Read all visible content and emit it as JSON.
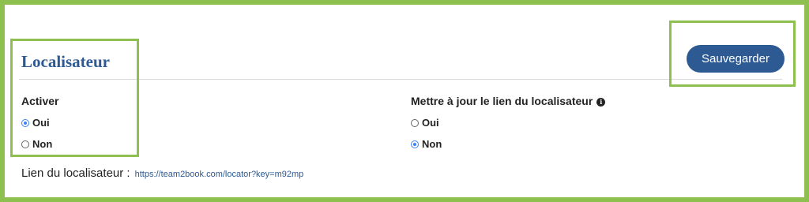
{
  "section": {
    "title": "Localisateur"
  },
  "toolbar": {
    "save_label": "Sauvegarder"
  },
  "activer": {
    "label": "Activer",
    "options": [
      {
        "label": "Oui",
        "checked": true
      },
      {
        "label": "Non",
        "checked": false
      }
    ]
  },
  "update_link": {
    "label": "Mettre à jour le lien du localisateur",
    "info_icon": "info-icon",
    "info_glyph": "i",
    "options": [
      {
        "label": "Oui",
        "checked": false
      },
      {
        "label": "Non",
        "checked": true
      }
    ]
  },
  "locator_link": {
    "label": "Lien du localisateur :",
    "url": "https://team2book.com/locator?key=m92mp"
  },
  "colors": {
    "accent": "#2d5a93",
    "highlight": "#8ec04f",
    "radio_checked": "#3b82f6"
  }
}
